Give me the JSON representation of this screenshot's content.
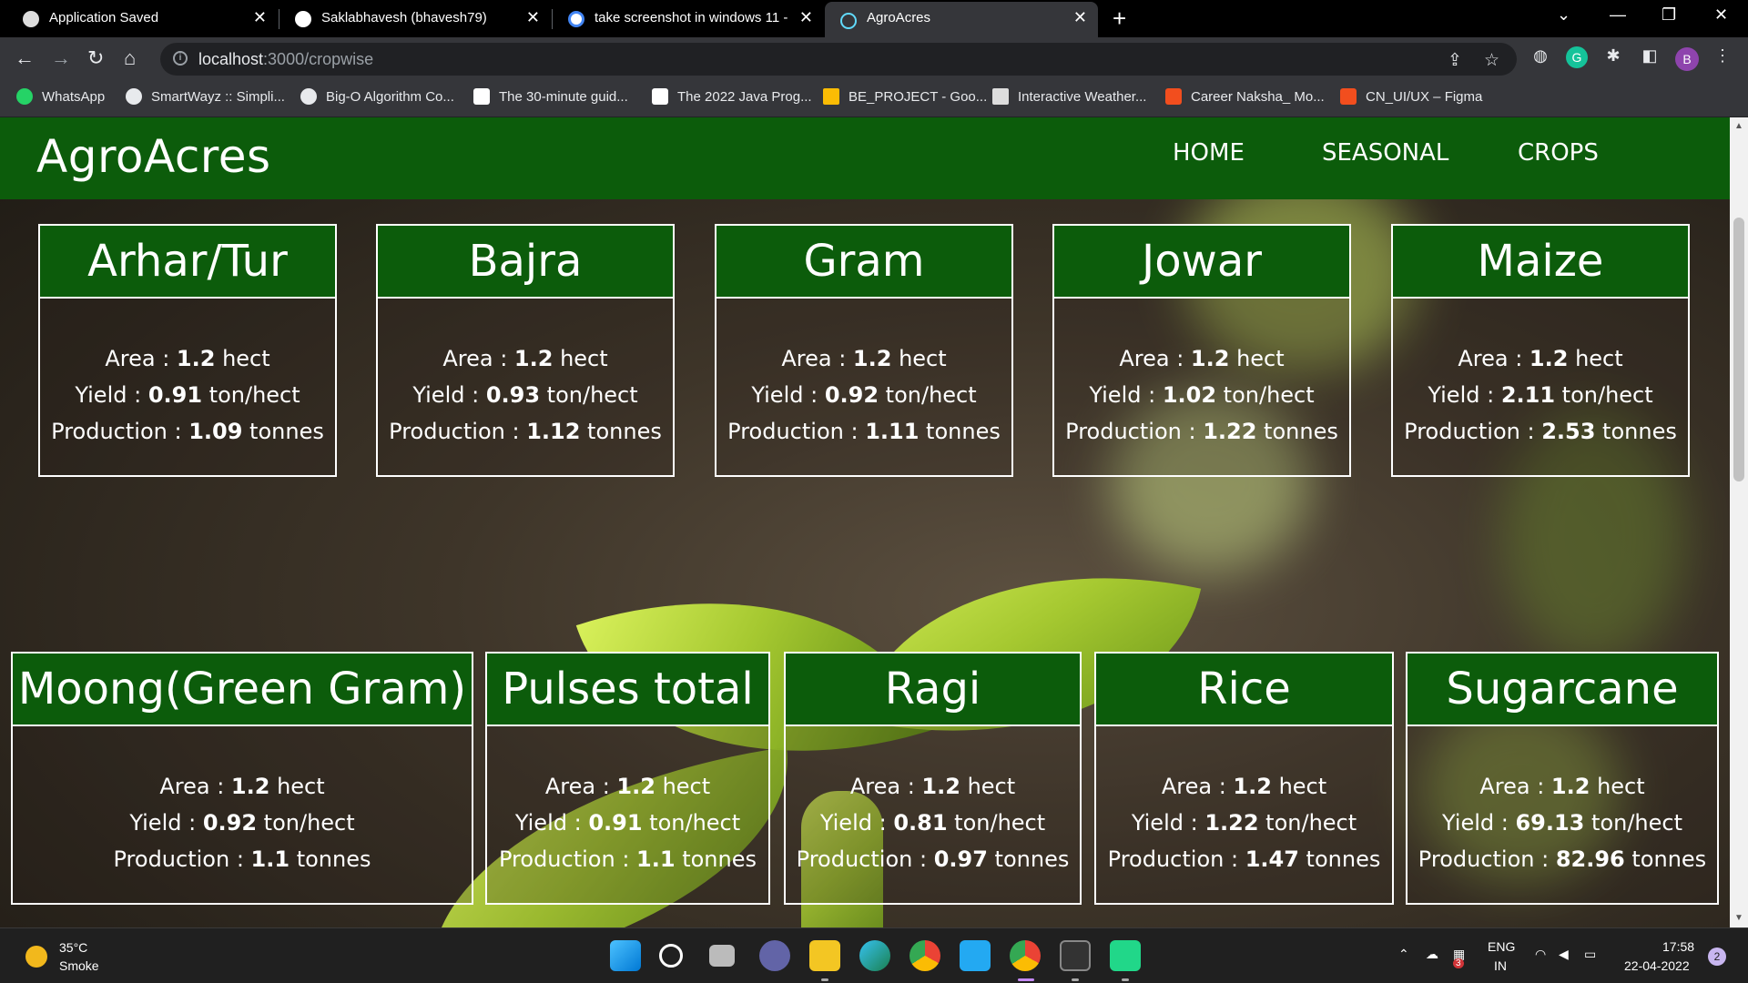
{
  "browser": {
    "tabs": [
      {
        "title": "Application Saved",
        "active": false
      },
      {
        "title": "Saklabhavesh (bhavesh79)",
        "active": false
      },
      {
        "title": "take screenshot in windows 11 - ",
        "active": false
      },
      {
        "title": "AgroAcres",
        "active": true
      }
    ],
    "address": {
      "host": "localhost",
      "path": ":3000/cropwise"
    },
    "profile_initial": "B",
    "bookmarks": [
      "WhatsApp",
      "SmartWayz :: Simpli...",
      "Big-O Algorithm Co...",
      "The 30-minute guid...",
      "The 2022 Java Prog...",
      "BE_PROJECT - Goo...",
      "Interactive Weather...",
      "Career Naksha_ Mo...",
      "CN_UI/UX – Figma"
    ]
  },
  "page": {
    "brand": "AgroAcres",
    "nav": [
      "HOME",
      "SEASONAL",
      "CROPS"
    ],
    "labels": {
      "area": "Area",
      "yield": "Yield",
      "production": "Production",
      "area_unit": "hect",
      "yield_unit": "ton/hect",
      "production_unit": "tonnes"
    },
    "crops": [
      {
        "name": "Arhar/Tur",
        "area": "1.2",
        "yield": "0.91",
        "production": "1.09"
      },
      {
        "name": "Bajra",
        "area": "1.2",
        "yield": "0.93",
        "production": "1.12"
      },
      {
        "name": "Gram",
        "area": "1.2",
        "yield": "0.92",
        "production": "1.11"
      },
      {
        "name": "Jowar",
        "area": "1.2",
        "yield": "1.02",
        "production": "1.22"
      },
      {
        "name": "Maize",
        "area": "1.2",
        "yield": "2.11",
        "production": "2.53"
      },
      {
        "name": "Moong(Green Gram)",
        "area": "1.2",
        "yield": "0.92",
        "production": "1.1"
      },
      {
        "name": "Pulses total",
        "area": "1.2",
        "yield": "0.91",
        "production": "1.1"
      },
      {
        "name": "Ragi",
        "area": "1.2",
        "yield": "0.81",
        "production": "0.97"
      },
      {
        "name": "Rice",
        "area": "1.2",
        "yield": "1.22",
        "production": "1.47"
      },
      {
        "name": "Sugarcane",
        "area": "1.2",
        "yield": "69.13",
        "production": "82.96"
      }
    ]
  },
  "taskbar": {
    "temperature": "35°C",
    "weather": "Smoke",
    "language": "ENG",
    "region": "IN",
    "time": "17:58",
    "date": "22-04-2022",
    "notification_count": "2",
    "badge_count": "3"
  }
}
